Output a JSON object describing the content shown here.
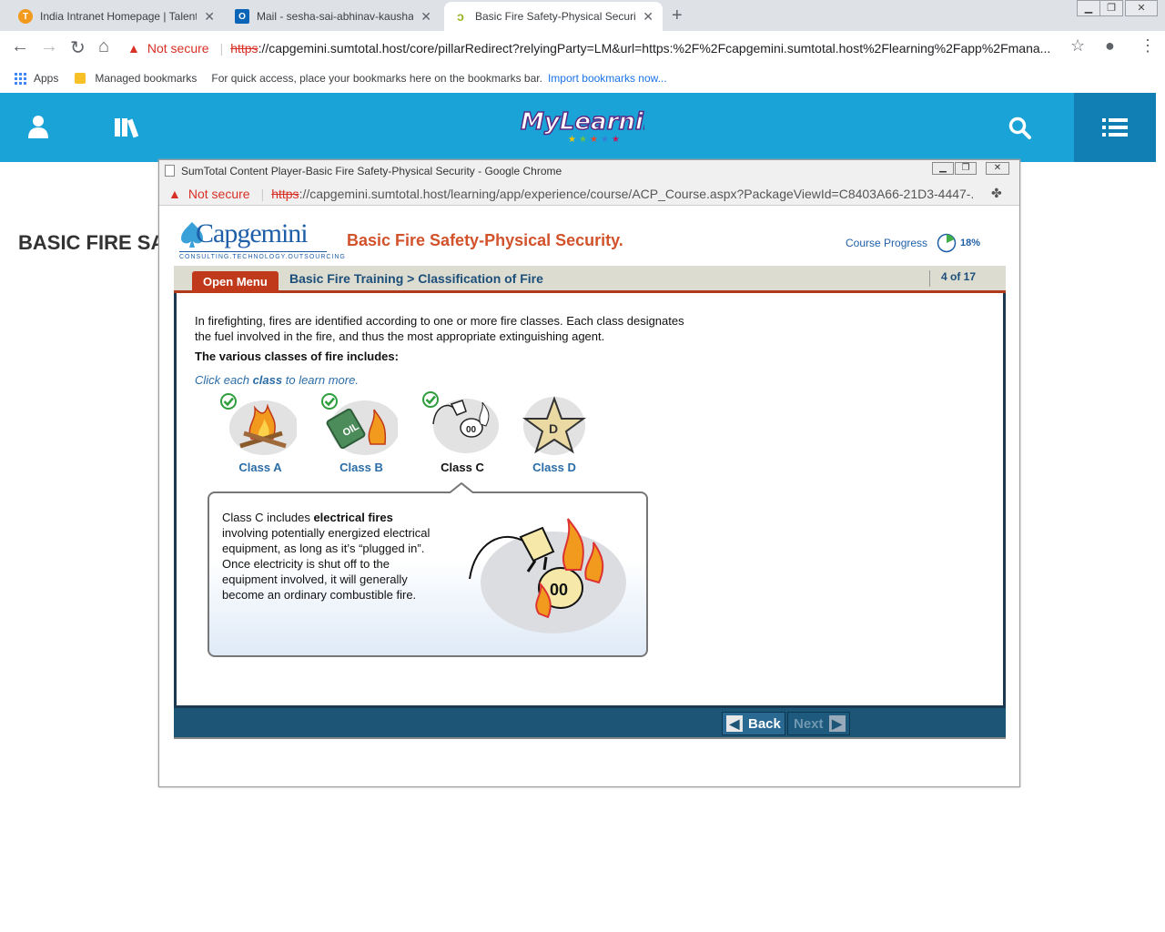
{
  "browser": {
    "tabs": [
      {
        "title": "India Intranet Homepage | Talent"
      },
      {
        "title": "Mail - sesha-sai-abhinav-kaushal"
      },
      {
        "title": "Basic Fire Safety-Physical Security"
      }
    ],
    "not_secure": "Not secure",
    "url_scheme": "https",
    "url_rest": "://capgemini.sumtotal.host/core/pillarRedirect?relyingParty=LM&url=https:%2F%2Fcapgemini.sumtotal.host%2Flearning%2Fapp%2Fmana...",
    "bookmarks": {
      "apps": "Apps",
      "managed": "Managed bookmarks",
      "hint": "For quick access, place your bookmarks here on the bookmarks bar.",
      "import": "Import bookmarks now..."
    }
  },
  "site": {
    "background_title": "BASIC FIRE SAI"
  },
  "popup": {
    "window_title": "SumTotal Content Player-Basic Fire Safety-Physical Security - Google Chrome",
    "not_secure": "Not secure",
    "url_scheme": "https",
    "url_rest": "://capgemini.sumtotal.host/learning/app/experience/course/ACP_Course.aspx?PackageViewId=C8403A66-21D3-4447-..."
  },
  "course": {
    "brand": "Capgemini",
    "tagline": "CONSULTING.TECHNOLOGY.OUTSOURCING",
    "title": "Basic Fire Safety-Physical Security.",
    "progress_label": "Course Progress",
    "progress_pct": "18%",
    "progress_value": 0.18,
    "open_menu": "Open Menu",
    "breadcrumb": "Basic Fire Training > Classification of Fire",
    "page_no": "4 of 17",
    "intro": "In firefighting, fires are identified according to one or more fire classes. Each class designates the fuel involved in the fire, and thus the most appropriate extinguishing agent.",
    "various": "The various classes of fire includes:",
    "click_pre": "Click each ",
    "click_bold": "class",
    "click_post": " to learn more.",
    "classes": [
      {
        "label": "Class A",
        "visited": true
      },
      {
        "label": "Class B",
        "visited": true
      },
      {
        "label": "Class C",
        "visited": true,
        "selected": true
      },
      {
        "label": "Class D",
        "visited": false
      }
    ],
    "class_d_letter": "D",
    "callout": {
      "pre": "Class C includes ",
      "bold": "electrical fires",
      "post": " involving potentially energized electrical equipment, as long as it’s “plugged in”. Once electricity is shut off to the equipment involved, it will generally become an ordinary combustible fire."
    },
    "back": "Back",
    "next": "Next"
  },
  "colors": {
    "site_bar": "#1aa3d7",
    "course_title": "#d2522b",
    "footer": "#1d5577"
  }
}
